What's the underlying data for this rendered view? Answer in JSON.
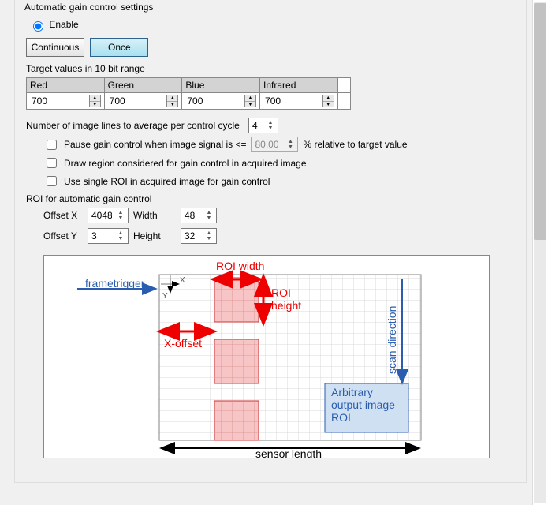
{
  "section": {
    "title": "Automatic gain control settings"
  },
  "enable": {
    "label": "Enable",
    "checked": true
  },
  "mode": {
    "continuous": "Continuous",
    "once": "Once",
    "active": "once"
  },
  "targetValues": {
    "caption": "Target values in 10 bit range",
    "columns": [
      "Red",
      "Green",
      "Blue",
      "Infrared"
    ],
    "values": [
      "700",
      "700",
      "700",
      "700"
    ]
  },
  "avgLines": {
    "label": "Number of image lines to average per control cycle",
    "value": "4"
  },
  "pause": {
    "label_pre": "Pause gain control when image signal is <=",
    "label_post": "% relative to target value",
    "value": "80,00",
    "checked": false
  },
  "drawRegion": {
    "label": "Draw region considered for gain control in acquired image",
    "checked": false
  },
  "singleROI": {
    "label": "Use single ROI in acquired image for gain control",
    "checked": false
  },
  "roi": {
    "title": "ROI for automatic gain control",
    "offsetX": {
      "label": "Offset X",
      "value": "4048"
    },
    "offsetY": {
      "label": "Offset Y",
      "value": "3"
    },
    "width": {
      "label": "Width",
      "value": "48"
    },
    "height": {
      "label": "Height",
      "value": "32"
    }
  },
  "diagram": {
    "frametrigger": "frametrigger",
    "roi_width": "ROI width",
    "roi_height_1": "ROI",
    "roi_height_2": "height",
    "x_offset": "X-offset",
    "scan_direction": "scan direction",
    "arb_1": "Arbitrary",
    "arb_2": "output image",
    "arb_3": "ROI",
    "sensor_length": "sensor length",
    "axis_x": "X",
    "axis_y": "Y"
  }
}
